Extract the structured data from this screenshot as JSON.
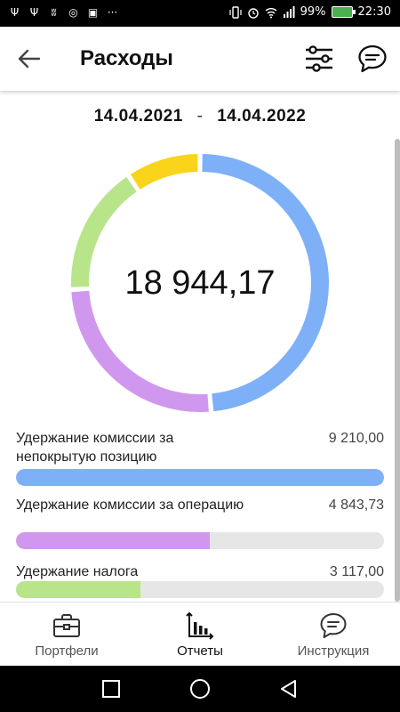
{
  "status_bar": {
    "battery": "99%",
    "time": "22:30",
    "battery_color": "#4caf50"
  },
  "app_bar": {
    "title": "Расходы",
    "back_icon": "arrow-left-icon",
    "filter_icon": "sliders-icon",
    "chat_icon": "chat-bubble-icon"
  },
  "period": {
    "from": "14.04.2021",
    "separator": "-",
    "to": "14.04.2022"
  },
  "summary": {
    "total": "18 944,17"
  },
  "chart_data": {
    "type": "pie",
    "donut": true,
    "center_label": "18 944,17",
    "slices": [
      {
        "name": "Удержание комиссии за непокрытую позицию",
        "value": 9210.0,
        "color": "#7eb0f7"
      },
      {
        "name": "Удержание комиссии за операцию",
        "value": 4843.73,
        "color": "#cf98ee"
      },
      {
        "name": "Удержание налога",
        "value": 3117.0,
        "color": "#b8e48a"
      },
      {
        "name": "",
        "value": 1773.44,
        "color": "#f9d41a"
      }
    ]
  },
  "expenses": [
    {
      "label": "Удержание комиссии за непокрытую позицию",
      "value": "9 210,00",
      "fraction": 1.0,
      "color": "#7eb0f7"
    },
    {
      "label": "Удержание комиссии за операцию",
      "value": "4 843,73",
      "fraction": 0.526,
      "color": "#cf98ee"
    },
    {
      "label": "Удержание налога",
      "value": "3 117,00",
      "fraction": 0.338,
      "color": "#b8e48a"
    }
  ],
  "bottom_nav": [
    {
      "label": "Портфели",
      "icon": "briefcase-icon",
      "active": false
    },
    {
      "label": "Отчеты",
      "icon": "bar-chart-icon",
      "active": true
    },
    {
      "label": "Инструкция",
      "icon": "chat-bubble-icon",
      "active": false
    }
  ],
  "system_nav": {
    "recents_icon": "square-icon",
    "home_icon": "circle-icon",
    "back_icon": "triangle-back-icon"
  }
}
